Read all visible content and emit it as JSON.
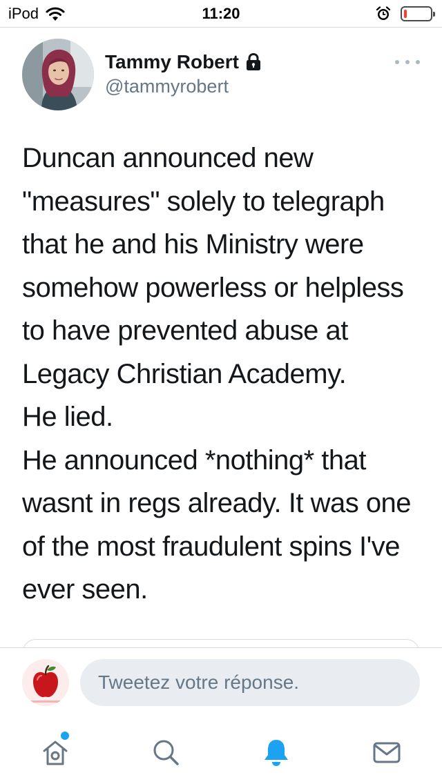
{
  "status_bar": {
    "carrier": "iPod",
    "time": "11:20",
    "battery_level": 0.12,
    "icons": [
      "wifi-icon",
      "alarm-icon",
      "battery-icon"
    ]
  },
  "tweet": {
    "author_name": "Tammy Robert",
    "author_handle": "@tammyrobert",
    "protected_icon": "lock-icon",
    "more_icon": "more-dots-icon",
    "text_lines": [
      "Duncan announced new",
      "\"measures\" solely to telegraph",
      "that he and his Ministry were",
      "somehow powerless or helpless",
      "to have prevented abuse at",
      "Legacy Christian Academy.",
      "He lied.",
      "He announced *nothing* that",
      "wasnt in regs already. It was one",
      "of the most fraudulent spins I've",
      "ever seen."
    ]
  },
  "reply": {
    "placeholder": "Tweetez votre réponse.",
    "value": ""
  },
  "tab_bar": {
    "tabs": [
      "home-icon",
      "search-icon",
      "notifications-icon",
      "messages-icon"
    ],
    "active": "notifications-icon",
    "home_has_new": true
  },
  "colors": {
    "accent": "#1da1f2",
    "text": "#14171a",
    "secondary_text": "#657786",
    "battery_low": "#ff3b30",
    "input_bg": "#e9edf1"
  }
}
